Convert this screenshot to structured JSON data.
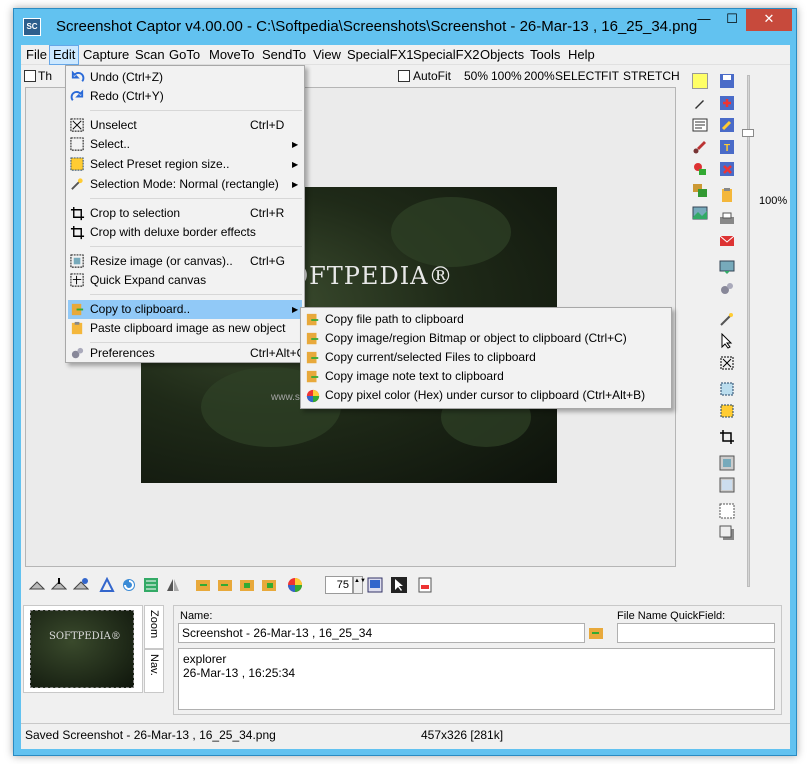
{
  "window": {
    "title": "Screenshot Captor v4.00.00 - C:\\Softpedia\\Screenshots\\Screenshot - 26-Mar-13 , 16_25_34.png",
    "app_icon_text": "SC",
    "min_glyph": "—",
    "max_glyph": "☐",
    "close_glyph": "✕"
  },
  "menubar": [
    "File",
    "Edit",
    "Capture",
    "Scan",
    "GoTo",
    "MoveTo",
    "SendTo",
    "View",
    "SpecialFX1",
    "SpecialFX2",
    "Objects",
    "Tools",
    "Help"
  ],
  "toolbar_top": {
    "checkbox_label": "Th",
    "autofit": "AutoFit",
    "zoom_50": "50%",
    "zoom_100": "100%",
    "zoom_200": "200%",
    "select": "SELECT",
    "fit": "FIT",
    "stretch": "STRETCH"
  },
  "image": {
    "logo": "SOFTPEDIA®",
    "sub": "www.softpedia.com"
  },
  "zoom_label": "100%",
  "edit_menu": [
    {
      "label": "Undo (Ctrl+Z)",
      "shortcut": "",
      "arrow": "",
      "icon": "undo-icon"
    },
    {
      "label": "Redo (Ctrl+Y)",
      "shortcut": "",
      "arrow": "",
      "icon": "redo-icon"
    },
    {
      "label": "Unselect",
      "shortcut": "Ctrl+D",
      "arrow": "",
      "icon": "unselect-icon"
    },
    {
      "label": "Select..",
      "shortcut": "",
      "arrow": "▶",
      "icon": "select-icon"
    },
    {
      "label": "Select Preset region size..",
      "shortcut": "",
      "arrow": "▶",
      "icon": "preset-region-icon"
    },
    {
      "label": "Selection Mode: Normal (rectangle)",
      "shortcut": "",
      "arrow": "▶",
      "icon": "selection-mode-icon"
    },
    {
      "label": "Crop to selection",
      "shortcut": "Ctrl+R",
      "arrow": "",
      "icon": "crop-icon"
    },
    {
      "label": "Crop with deluxe border effects",
      "shortcut": "",
      "arrow": "",
      "icon": "crop-deluxe-icon"
    },
    {
      "label": "Resize image (or canvas)..",
      "shortcut": "Ctrl+G",
      "arrow": "",
      "icon": "resize-icon"
    },
    {
      "label": "Quick Expand canvas",
      "shortcut": "",
      "arrow": "",
      "icon": "expand-icon"
    },
    {
      "label": "Copy to clipboard..",
      "shortcut": "",
      "arrow": "▶",
      "icon": "clipboard-copy-icon"
    },
    {
      "label": "Paste clipboard image as new object",
      "shortcut": "",
      "arrow": "",
      "icon": "paste-icon"
    },
    {
      "label": "Preferences",
      "shortcut": "Ctrl+Alt+O",
      "arrow": "",
      "icon": "preferences-icon"
    }
  ],
  "clipboard_submenu": [
    {
      "label": "Copy file path to clipboard",
      "icon": "copy-path-icon"
    },
    {
      "label": "Copy image/region Bitmap or object to clipboard (Ctrl+C)",
      "icon": "copy-bitmap-icon"
    },
    {
      "label": "Copy current/selected Files to clipboard",
      "icon": "copy-files-icon"
    },
    {
      "label": "Copy image note text to clipboard",
      "icon": "copy-note-icon"
    },
    {
      "label": "Copy pixel color (Hex) under cursor to clipboard (Ctrl+Alt+B)",
      "icon": "color-wheel-icon"
    }
  ],
  "bottom_toolbar": {
    "quality": "75",
    "spin_glyph": "▲▼"
  },
  "thumbnail": {
    "logo": "SOFTPEDIA®",
    "tab_zoom": "Zoom",
    "tab_nav": "Nav."
  },
  "meta": {
    "name_label": "Name:",
    "name_value": "Screenshot - 26-Mar-13 , 16_25_34",
    "quickfield_label": "File Name QuickField:",
    "notes_line1": "explorer",
    "notes_line2": "26-Mar-13 , 16:25:34"
  },
  "status": {
    "left": "Saved Screenshot - 26-Mar-13 , 16_25_34.png",
    "mid": "457x326  [281k]"
  },
  "colors": {
    "title_bar": "#62c2f0",
    "close_button": "#c74a3c",
    "menu_highlight": "#91c9f7"
  }
}
